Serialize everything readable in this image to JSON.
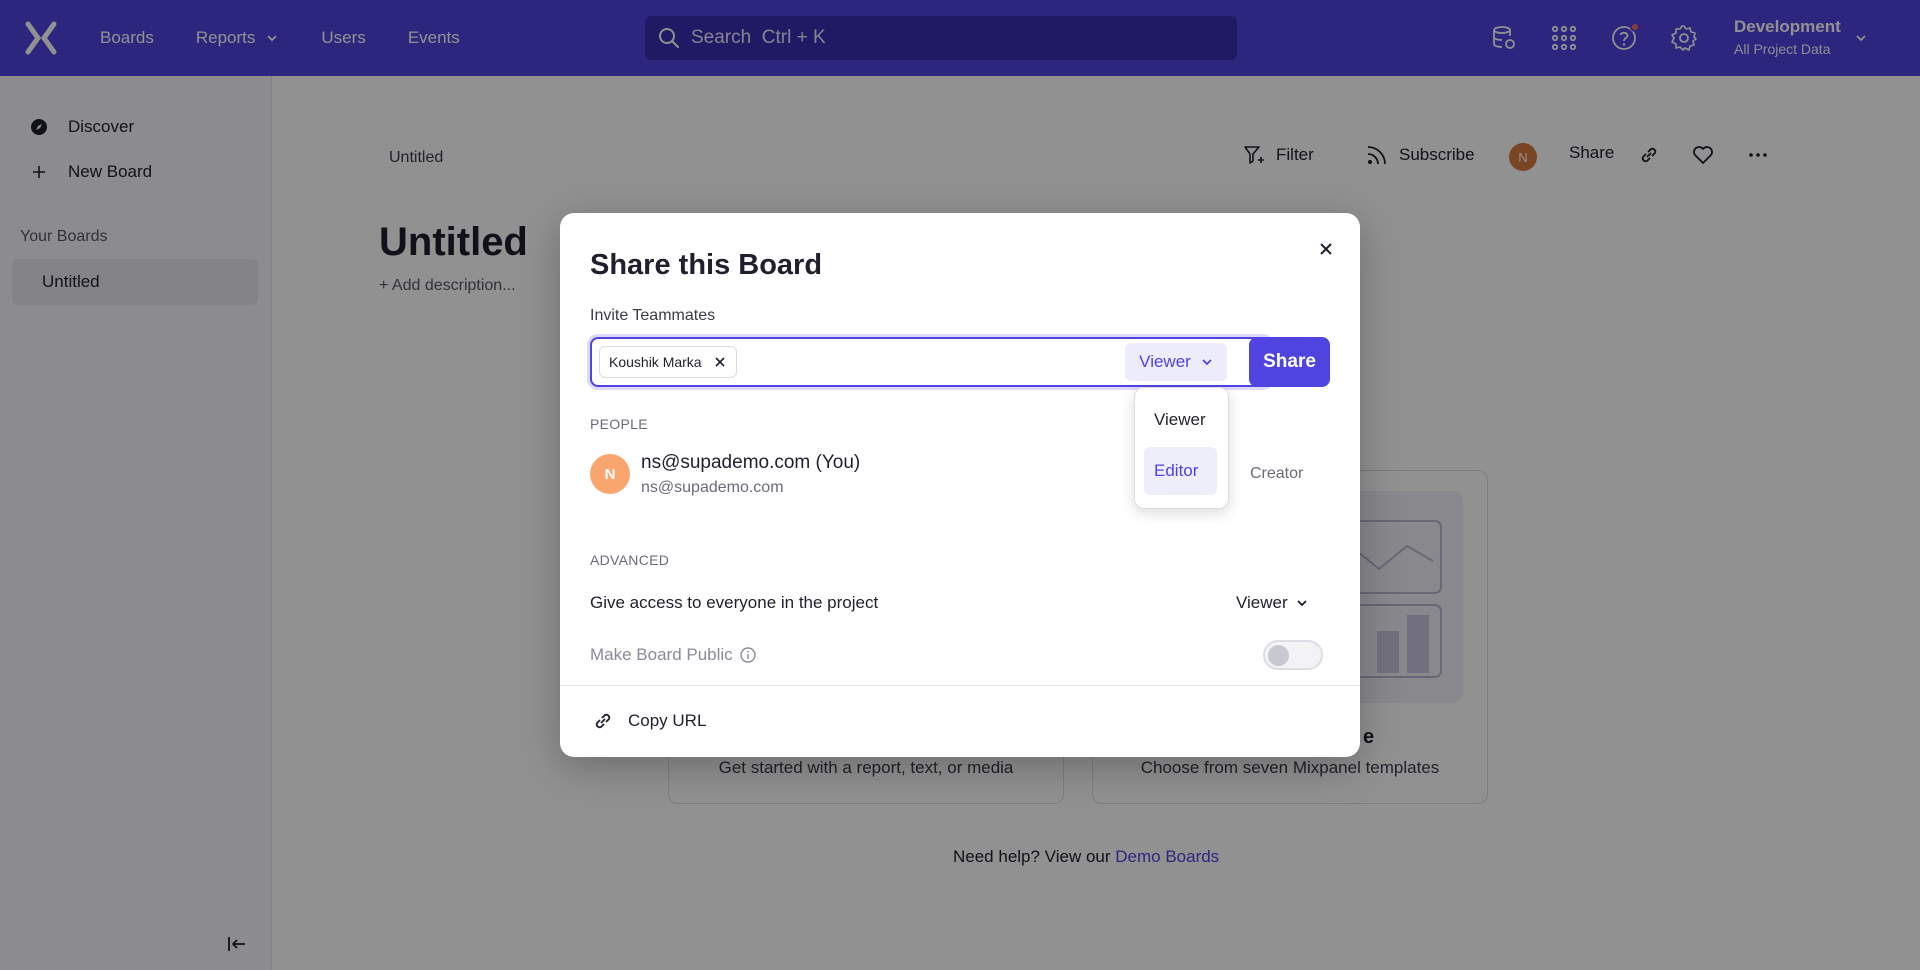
{
  "nav": {
    "links": [
      {
        "label": "Boards"
      },
      {
        "label": "Reports",
        "has_dropdown": true
      },
      {
        "label": "Users"
      },
      {
        "label": "Events"
      }
    ],
    "search": {
      "placeholder": "Search  Ctrl + K"
    },
    "project": {
      "name": "Development",
      "scope": "All Project Data"
    }
  },
  "sidebar": {
    "items": [
      {
        "label": "Discover"
      },
      {
        "label": "New Board"
      }
    ],
    "your_boards_heading": "Your Boards",
    "boards": [
      {
        "label": "Untitled"
      }
    ]
  },
  "main": {
    "breadcrumb": "Untitled",
    "toolbar": {
      "filter_label": "Filter",
      "subscribe_label": "Subscribe",
      "avatar_initial": "N",
      "share_label": "Share"
    },
    "title": "Untitled",
    "description_placeholder": "+ Add description...",
    "cards": [
      {
        "title": "",
        "subtitle": "Get started with a report, text, or media"
      },
      {
        "title": "e",
        "subtitle": "Choose from seven Mixpanel templates"
      }
    ],
    "help_text": "Need help? View our",
    "help_link": "Demo Boards"
  },
  "modal": {
    "title": "Share this Board",
    "invite_label": "Invite Teammates",
    "invitees": [
      {
        "name": "Koushik Marka"
      }
    ],
    "selected_role": "Viewer",
    "share_button": "Share",
    "people_heading": "PEOPLE",
    "people": [
      {
        "initial": "N",
        "name": "ns@supademo.com (You)",
        "email": "ns@supademo.com",
        "role": "Creator"
      }
    ],
    "advanced_heading": "ADVANCED",
    "project_access_label": "Give access to everyone in the project",
    "project_access_role": "Viewer",
    "public_label": "Make Board Public",
    "public_enabled": false,
    "copy_url_label": "Copy URL"
  },
  "role_dropdown": {
    "options": [
      {
        "label": "Viewer"
      },
      {
        "label": "Editor",
        "highlighted": true
      }
    ]
  },
  "colors": {
    "brand": "#4f44e0",
    "avatar_orange": "#fba56e"
  }
}
